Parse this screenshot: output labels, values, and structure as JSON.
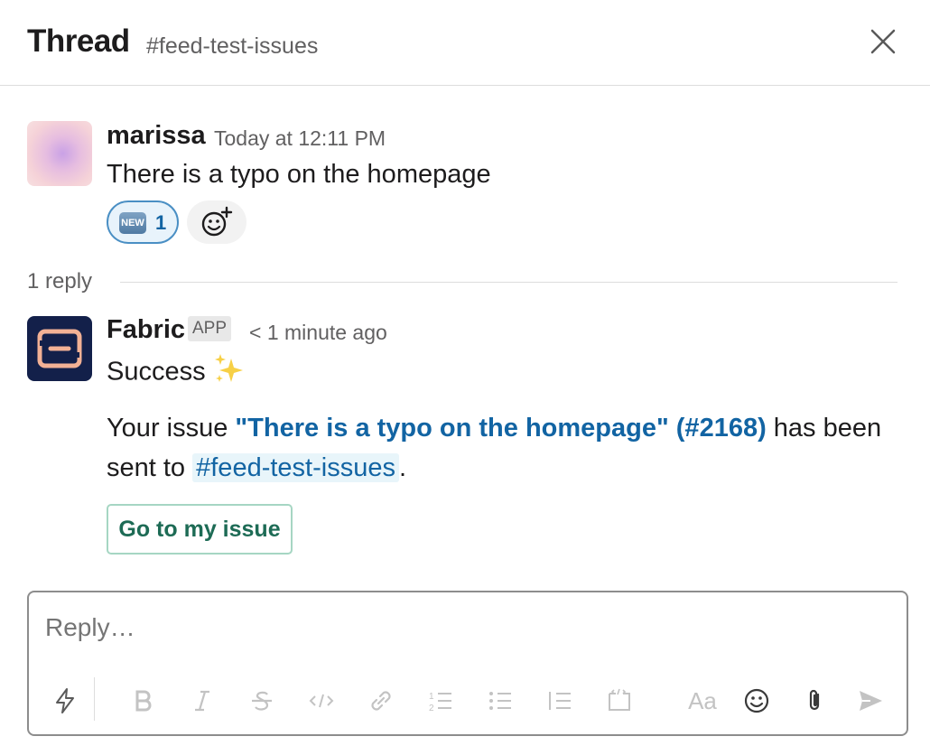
{
  "header": {
    "title": "Thread",
    "channel": "#feed-test-issues"
  },
  "parent_message": {
    "author": "marissa",
    "timestamp": "Today at 12:11 PM",
    "text": "There is a typo on the homepage",
    "reaction": {
      "emoji_label": "NEW",
      "count": "1"
    }
  },
  "replies": {
    "count_label": "1 reply"
  },
  "reply_message": {
    "author": "Fabric",
    "badge": "APP",
    "timestamp": "< 1 minute ago",
    "status": "Success",
    "body_prefix": "Your issue ",
    "issue_link": "\"There is a typo on the homepage\" (#2168)",
    "body_middle": " has been sent to ",
    "channel_link": "#feed-test-issues",
    "body_suffix": ".",
    "button_label": "Go to my issue"
  },
  "composer": {
    "placeholder": "Reply…",
    "text_format_label": "Aa"
  },
  "colors": {
    "link": "#1264a3",
    "button_text": "#1d6b55",
    "reaction_border": "#4a8fc4"
  }
}
